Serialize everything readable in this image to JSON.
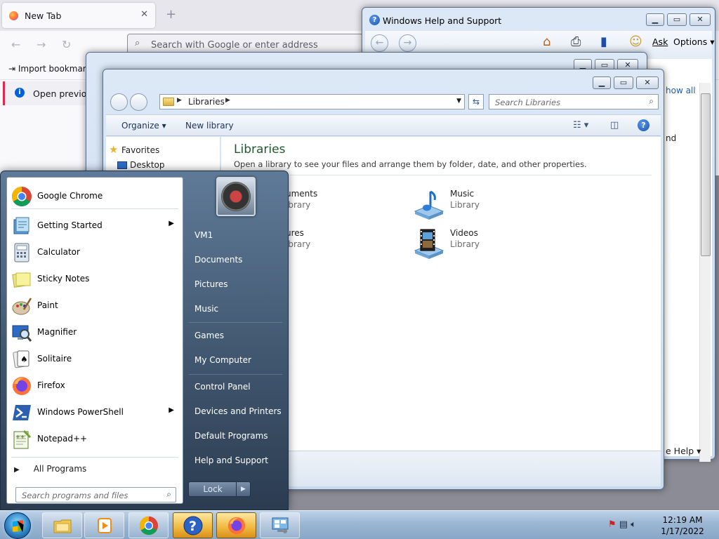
{
  "firefox": {
    "tab_title": "New Tab",
    "tab_close": "✕",
    "new_tab": "+",
    "search_placeholder": "Search with Google or enter address",
    "import_bookmarks": "Import bookmarks",
    "notice": "Open previous"
  },
  "help": {
    "title": "Windows Help and Support",
    "ask": "Ask",
    "options": "Options",
    "show_all": "how all",
    "partial_nd": "nd",
    "help_menu": "e Help"
  },
  "explorer": {
    "breadcrumb": "Libraries",
    "search_placeholder": "Search Libraries",
    "organize": "Organize",
    "new_library": "New library",
    "navpane": {
      "favorites": "Favorites",
      "desktop": "Desktop"
    },
    "heading": "Libraries",
    "description": "Open a library to see your files and arrange them by folder, date, and other properties.",
    "libraries": [
      {
        "name": "uments",
        "type": "ibrary"
      },
      {
        "name": "Music",
        "type": "Library"
      },
      {
        "name": "ures",
        "type": "ibrary"
      },
      {
        "name": "Videos",
        "type": "Library"
      }
    ]
  },
  "start_menu": {
    "programs": [
      {
        "label": "Google Chrome",
        "icon": "chrome-icon"
      },
      {
        "label": "Getting Started",
        "icon": "getting-started-icon",
        "submenu": true
      },
      {
        "label": "Calculator",
        "icon": "calculator-icon"
      },
      {
        "label": "Sticky Notes",
        "icon": "sticky-notes-icon"
      },
      {
        "label": "Paint",
        "icon": "paint-icon"
      },
      {
        "label": "Magnifier",
        "icon": "magnifier-icon"
      },
      {
        "label": "Solitaire",
        "icon": "solitaire-icon"
      },
      {
        "label": "Firefox",
        "icon": "firefox-icon"
      },
      {
        "label": "Windows PowerShell",
        "icon": "powershell-icon",
        "submenu": true
      },
      {
        "label": "Notepad++",
        "icon": "notepadpp-icon"
      }
    ],
    "all_programs": "All Programs",
    "search_placeholder": "Search programs and files",
    "right_items": [
      "VM1",
      "Documents",
      "Pictures",
      "Music",
      "Games",
      "My Computer",
      "Control Panel",
      "Devices and Printers",
      "Default Programs",
      "Help and Support"
    ],
    "lock": "Lock"
  },
  "taskbar": {
    "time": "12:19 AM",
    "date": "1/17/2022"
  }
}
